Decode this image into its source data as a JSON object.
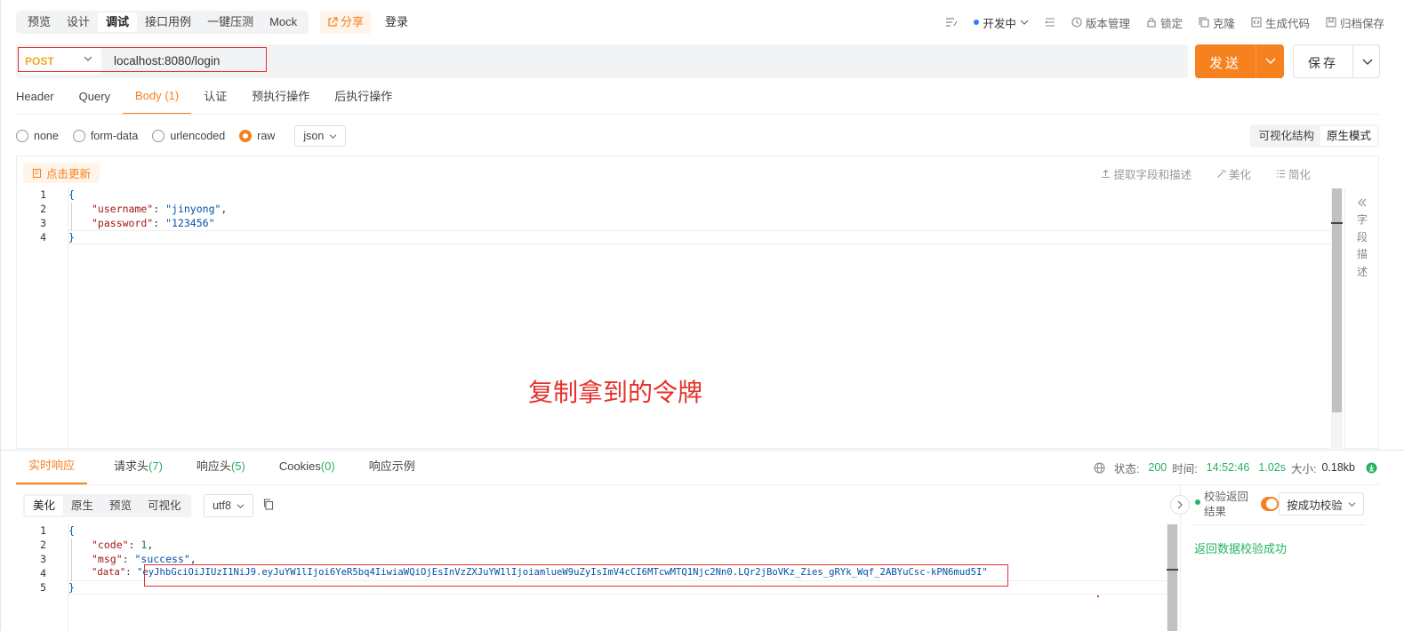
{
  "top_tabs": [
    "预览",
    "设计",
    "调试",
    "接口用例",
    "一键压测",
    "Mock"
  ],
  "share_label": "分享",
  "login_label": "登录",
  "top_right": {
    "env": "开发中",
    "version": "版本管理",
    "lock": "锁定",
    "clone": "克隆",
    "gen_code": "生成代码",
    "archive": "归档保存"
  },
  "request": {
    "method": "POST",
    "url": "localhost:8080/login",
    "send_label": "发送",
    "save_label": "保存"
  },
  "request_tabs": [
    {
      "label": "Header"
    },
    {
      "label": "Query"
    },
    {
      "label": "Body",
      "count": "(1)"
    },
    {
      "label": "认证"
    },
    {
      "label": "预执行操作"
    },
    {
      "label": "后执行操作"
    }
  ],
  "body_types": [
    "none",
    "form-data",
    "urlencoded",
    "raw"
  ],
  "body_format": "json",
  "view_modes": [
    "可视化结构",
    "原生模式"
  ],
  "editor": {
    "update_button": "点击更新",
    "tools": [
      "提取字段和描述",
      "美化",
      "简化"
    ],
    "side_panel": [
      "字",
      "段",
      "描",
      "述"
    ],
    "line_numbers": [
      "1",
      "2",
      "3",
      "4"
    ],
    "open_brace": "{",
    "close_brace": "}",
    "lines": [
      {
        "key": "\"username\"",
        "value": "\"jinyong\"",
        "trail": ","
      },
      {
        "key": "\"password\"",
        "value": "\"123456\"",
        "trail": ""
      }
    ]
  },
  "annotation": "复制拿到的令牌",
  "response_tabs": [
    {
      "label": "实时响应"
    },
    {
      "label": "请求头",
      "count": "(7)"
    },
    {
      "label": "响应头",
      "count": "(5)"
    },
    {
      "label": "Cookies",
      "count": "(0)"
    },
    {
      "label": "响应示例"
    }
  ],
  "status": {
    "status_label": "状态:",
    "status_value": "200",
    "time_label": "时间:",
    "time_value": "14:52:46",
    "duration": "1.02s",
    "size_label": "大小:",
    "size_value": "0.18kb"
  },
  "response_tools": [
    "美化",
    "原生",
    "预览",
    "可视化"
  ],
  "encoding": "utf8",
  "response_code": {
    "line_numbers": [
      "1",
      "2",
      "3",
      "4",
      "5"
    ],
    "open_brace": "{",
    "close_brace": "}",
    "code_key": "\"code\"",
    "code_value": "1",
    "msg_key": "\"msg\"",
    "msg_value": "\"success\"",
    "data_key": "\"data\"",
    "data_value": "\"eyJhbGciOiJIUzI1NiJ9.eyJuYW1lIjoi6YeR5bq4IiwiaWQiOjEsInVzZXJuYW1lIjoiamlueW9uZyIsImV4cCI6MTcwMTQ1Njc2Nn0.LQr2jBoVKz_Zies_gRYk_Wqf_2ABYuCsc-kPN6mud5I\""
  },
  "validation": {
    "label": "校验返回结果",
    "select": "按成功校验",
    "message": "返回数据校验成功"
  },
  "colors": {
    "accent": "#f5821f",
    "success": "#24b35f",
    "annotation": "#e5312d"
  }
}
